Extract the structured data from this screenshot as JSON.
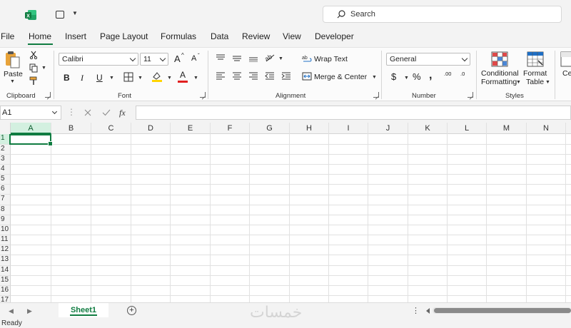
{
  "titlebar": {
    "search_placeholder": "Search"
  },
  "menu": {
    "items": [
      "File",
      "Home",
      "Insert",
      "Page Layout",
      "Formulas",
      "Data",
      "Review",
      "View",
      "Developer"
    ],
    "active": "Home"
  },
  "ribbon": {
    "clipboard": {
      "paste_label": "Paste",
      "group_label": "Clipboard"
    },
    "font": {
      "font_name": "Calibri",
      "font_size": "11",
      "group_label": "Font",
      "bold": "B",
      "italic": "I",
      "underline": "U",
      "grow": "A",
      "shrink": "A",
      "font_color_glyph": "A"
    },
    "alignment": {
      "wrap_text": "Wrap Text",
      "merge_center": "Merge & Center",
      "group_label": "Alignment"
    },
    "number": {
      "format": "General",
      "currency": "$",
      "percent": "%",
      "comma": ",",
      "group_label": "Number",
      "inc_decimal": ".00",
      "dec_decimal": ".0"
    },
    "styles": {
      "conditional_1": "Conditional",
      "conditional_2": "Formatting",
      "format_table_1": "Format",
      "format_table_2": "Table",
      "group_label": "Styles",
      "cell_styles_partial": "Ce"
    }
  },
  "formula_bar": {
    "name_box": "A1",
    "fx": "fx",
    "value": ""
  },
  "grid": {
    "columns": [
      "A",
      "B",
      "C",
      "D",
      "E",
      "F",
      "G",
      "H",
      "I",
      "J",
      "K",
      "L",
      "M",
      "N"
    ],
    "rows": [
      "1",
      "2",
      "3",
      "4",
      "5",
      "6",
      "7",
      "8",
      "9",
      "10",
      "11",
      "12",
      "13",
      "14",
      "15",
      "16",
      "17"
    ],
    "selected_cell": "A1"
  },
  "sheets": {
    "tabs": [
      "Sheet1"
    ],
    "active": "Sheet1"
  },
  "status": {
    "text": "Ready"
  },
  "watermark": {
    "text": "خمسات"
  },
  "colors": {
    "accent": "#107c41",
    "selection_fill": "#d3f0e0"
  }
}
